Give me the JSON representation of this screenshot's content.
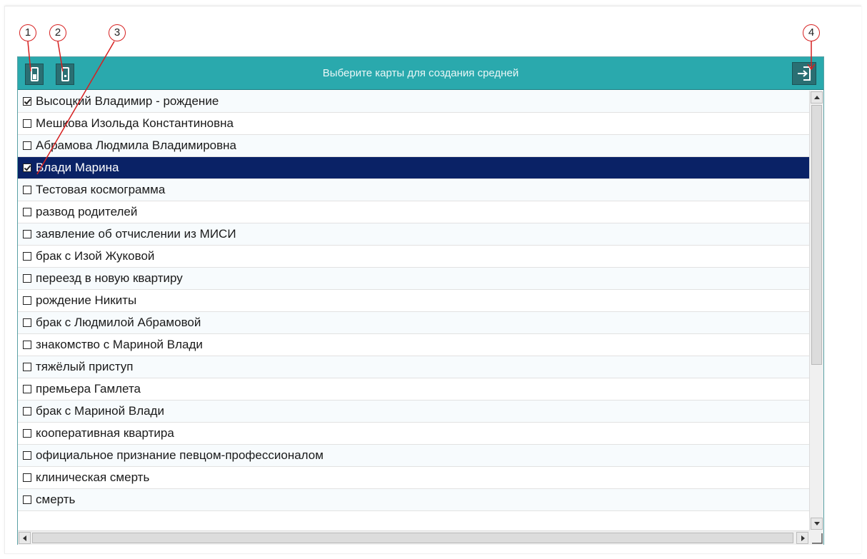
{
  "title": "Выберите карты для создания средней",
  "callouts": [
    "1",
    "2",
    "3",
    "4"
  ],
  "toolbar": {
    "select_all_icon": "checkbox-filled-icon",
    "select_none_icon": "checkbox-empty-icon",
    "exit_icon": "login-arrow-icon"
  },
  "colors": {
    "titlebar": "#2aa9ad",
    "selected_row": "#0a2266",
    "callout": "#d62020"
  },
  "items": [
    {
      "label": "Высоцкий Владимир - рождение",
      "checked": true,
      "selected": false
    },
    {
      "label": "Мешкова Изольда Константиновна",
      "checked": false,
      "selected": false
    },
    {
      "label": "Абрамова Людмила Владимировна",
      "checked": false,
      "selected": false
    },
    {
      "label": "Влади Марина",
      "checked": true,
      "selected": true
    },
    {
      "label": "Тестовая космограмма",
      "checked": false,
      "selected": false
    },
    {
      "label": "развод родителей",
      "checked": false,
      "selected": false
    },
    {
      "label": "заявление об отчислении из МИСИ",
      "checked": false,
      "selected": false
    },
    {
      "label": "брак с Изой Жуковой",
      "checked": false,
      "selected": false
    },
    {
      "label": "переезд в новую квартиру",
      "checked": false,
      "selected": false
    },
    {
      "label": "рождение Никиты",
      "checked": false,
      "selected": false
    },
    {
      "label": "брак с Людмилой Абрамовой",
      "checked": false,
      "selected": false
    },
    {
      "label": "знакомство с Мариной Влади",
      "checked": false,
      "selected": false
    },
    {
      "label": "тяжёлый приступ",
      "checked": false,
      "selected": false
    },
    {
      "label": "премьера Гамлета",
      "checked": false,
      "selected": false
    },
    {
      "label": "брак с Мариной Влади",
      "checked": false,
      "selected": false
    },
    {
      "label": "кооперативная квартира",
      "checked": false,
      "selected": false
    },
    {
      "label": "официальное признание певцом-профессионалом",
      "checked": false,
      "selected": false
    },
    {
      "label": "клиническая смерть",
      "checked": false,
      "selected": false
    },
    {
      "label": "смерть",
      "checked": false,
      "selected": false
    }
  ]
}
